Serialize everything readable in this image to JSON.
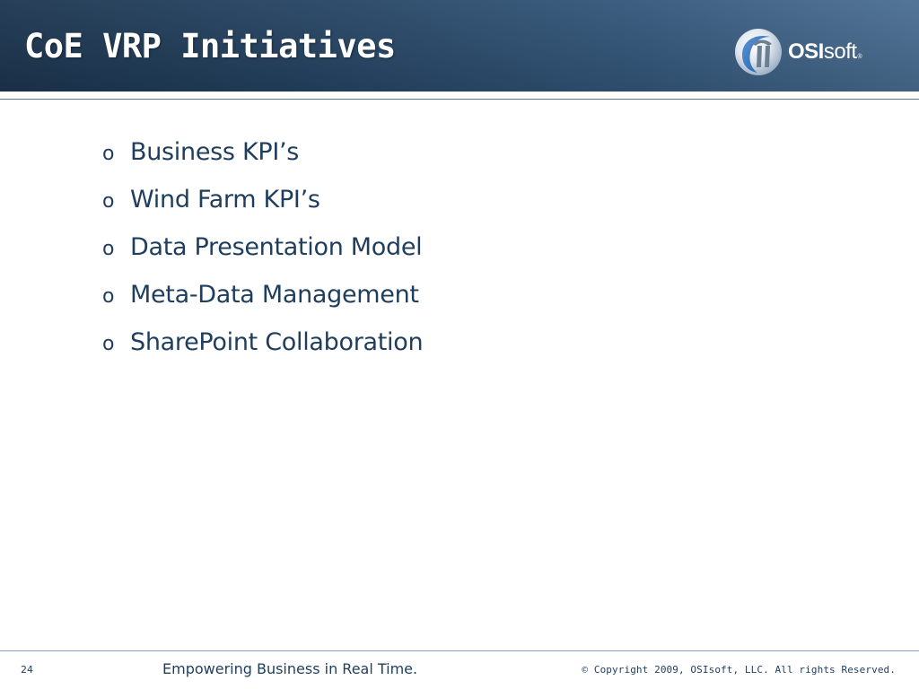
{
  "slide": {
    "title": "CoE VRP Initiatives",
    "bullet_symbol": "o",
    "bullets": [
      "Business KPI’s",
      "Wind Farm KPI’s",
      "Data Presentation Model",
      "Meta-Data Management",
      "SharePoint Collaboration"
    ]
  },
  "logo": {
    "bold_text": "OSI",
    "light_text": "soft",
    "registered": "®",
    "icon": "osisoft-pi-logo-icon"
  },
  "footer": {
    "page_number": "24",
    "tagline": "Empowering Business in Real Time.",
    "copyright": "© Copyright 2009, OSIsoft, LLC.  All rights Reserved."
  },
  "colors": {
    "header_dark": "#1c3550",
    "header_light": "#4a6e92",
    "text_blue": "#1f3d5c",
    "background": "#ffffff"
  }
}
